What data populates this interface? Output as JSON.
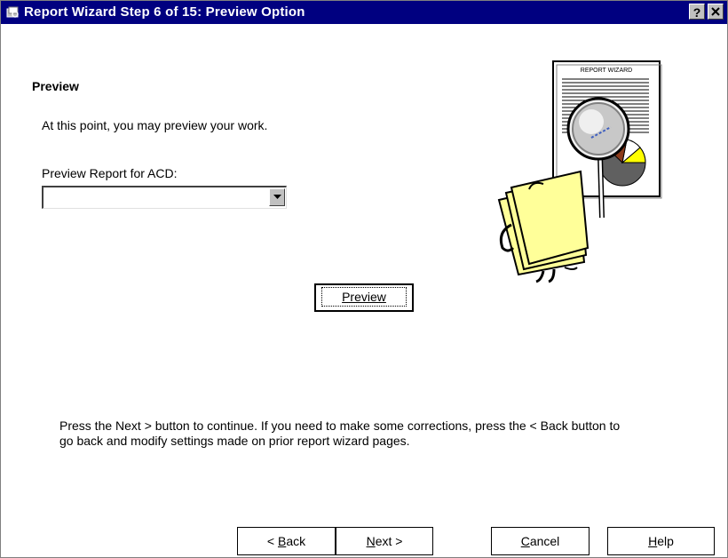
{
  "window": {
    "title": "Report Wizard Step 6 of 15: Preview Option",
    "help_glyph": "?",
    "close_glyph": "✕"
  },
  "content": {
    "heading": "Preview",
    "intro": "At this point, you may preview your work.",
    "select_label": "Preview Report for ACD:",
    "select_value": "",
    "preview_button": "Preview",
    "instructions_line1": "Press the Next > button to continue. If you need to make some corrections, press the < Back button to",
    "instructions_line2": "go back and modify settings made on prior report wizard pages."
  },
  "illustration": {
    "label": "REPORT WIZARD",
    "icon": "report-wizard-magnifier-character"
  },
  "footer": {
    "back_prefix": "< ",
    "back_hot": "B",
    "back_rest": "ack",
    "next_hot": "N",
    "next_rest": "ext >",
    "cancel_hot": "C",
    "cancel_rest": "ancel",
    "help_hot": "H",
    "help_rest": "elp"
  },
  "colors": {
    "titlebar": "#000080",
    "face": "#c0c0c0",
    "paper_yellow": "#ffff99"
  }
}
